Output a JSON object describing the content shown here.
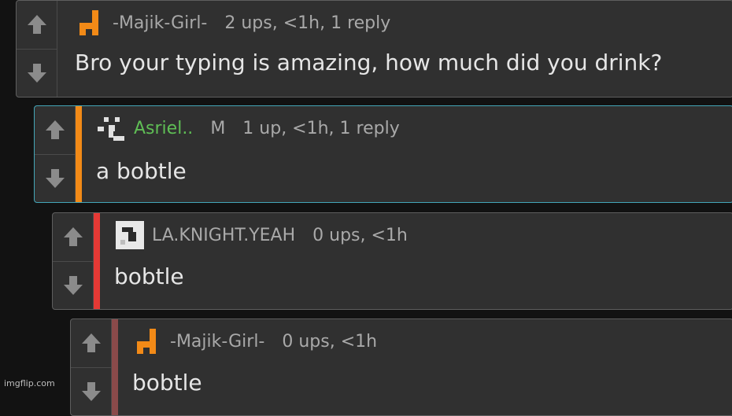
{
  "comments": [
    {
      "username": "-Majik-Girl-",
      "stats": "2 ups, <1h, 1 reply",
      "text": "Bro your typing is amazing, how much did you drink?",
      "bar_color": "",
      "avatar": "orange-chair-icon"
    },
    {
      "username": "Asriel..",
      "username_color": "#5fbe55",
      "flair": "M",
      "stats": "1 up, <1h, 1 reply",
      "text": "a bobtle",
      "bar_color": "#f28a17",
      "avatar": "pixel-face-icon"
    },
    {
      "username": "LA.KNIGHT.YEAH",
      "stats": "0 ups, <1h",
      "text": "bobtle",
      "bar_color": "#e53935",
      "avatar": "pixel-square-icon"
    },
    {
      "username": "-Majik-Girl-",
      "stats": "0 ups, <1h",
      "text": "bobtle",
      "bar_color": "#8a4a4a",
      "avatar": "orange-chair-icon"
    }
  ],
  "watermark": "imgflip.com",
  "colors": {
    "background": "#121212",
    "panel": "#303030",
    "border": "#5e5e5e",
    "active_border": "#43a6b8",
    "orange_avatar": "#f28a17"
  }
}
